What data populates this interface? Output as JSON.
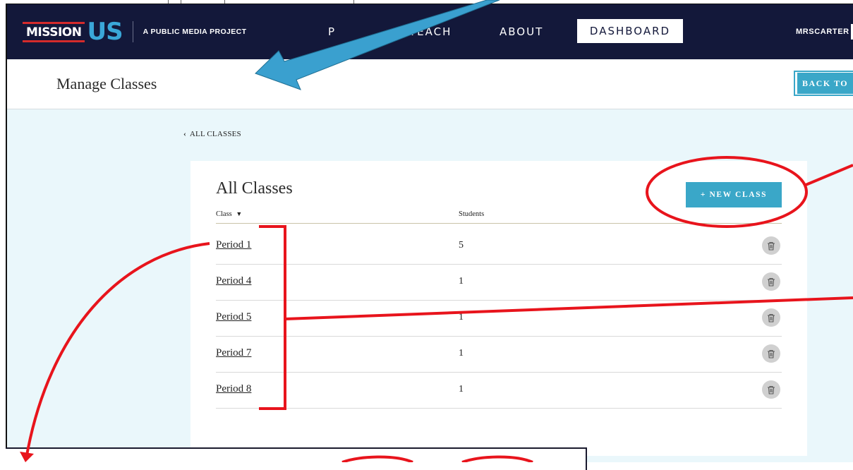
{
  "nav": {
    "logo_mission": "MISSION",
    "logo_us": "US",
    "tagline": "A PUBLIC MEDIA PROJECT",
    "items": [
      {
        "label": "P"
      },
      {
        "label": "TEACH"
      },
      {
        "label": "ABOUT"
      }
    ],
    "active_item": "DASHBOARD",
    "username": "MRSCARTER"
  },
  "header": {
    "title": "Manage Classes",
    "back_button": "BACK TO"
  },
  "breadcrumb": {
    "label": "ALL CLASSES"
  },
  "card": {
    "title": "All Classes",
    "new_button": "+ NEW CLASS",
    "columns": {
      "class": "Class",
      "students": "Students"
    },
    "rows": [
      {
        "name": "Period 1",
        "students": "5"
      },
      {
        "name": "Period 4",
        "students": "1"
      },
      {
        "name": "Period 5",
        "students": "1"
      },
      {
        "name": "Period 7",
        "students": "1"
      },
      {
        "name": "Period 8",
        "students": "1"
      }
    ]
  },
  "colors": {
    "nav_bg": "#13183a",
    "accent": "#3aa7c8",
    "annotation_red": "#e8141c",
    "annotation_arrow": "#3aa0cf",
    "page_bg": "#eaf7fb"
  },
  "icons": {
    "delete": "trash-icon",
    "sort": "sort-down-icon",
    "back": "chevron-left-icon"
  }
}
